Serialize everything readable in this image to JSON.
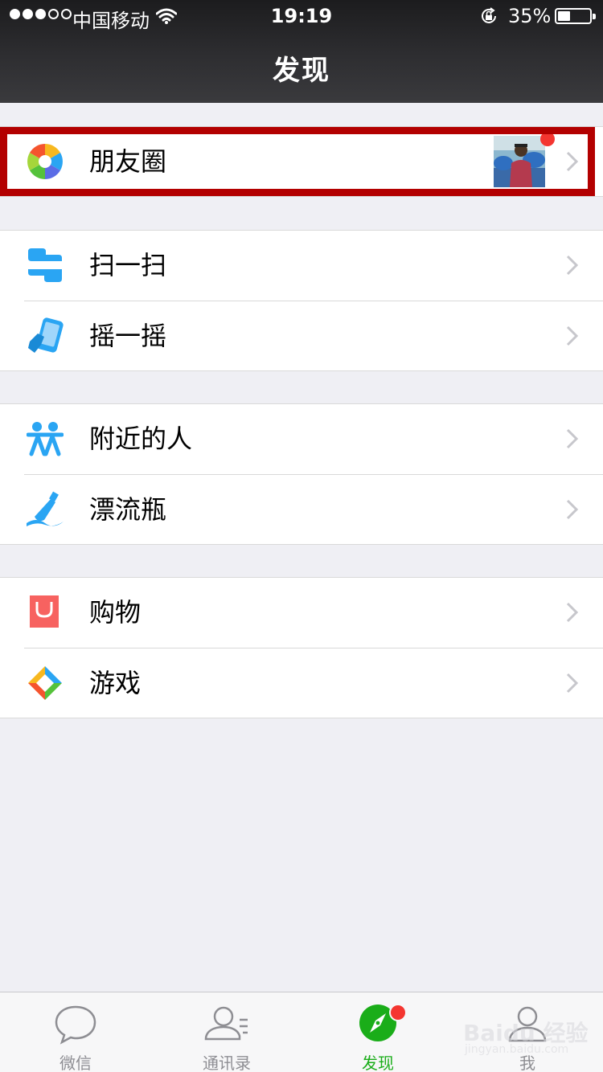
{
  "status_bar": {
    "signal_bars": 3,
    "signal_total": 5,
    "carrier": "中国移动",
    "time": "19:19",
    "battery_percent": "35%",
    "battery_level": 0.35
  },
  "nav": {
    "title": "发现"
  },
  "menu": {
    "moments": {
      "label": "朋友圈",
      "icon": "moments-aperture-icon",
      "has_new_badge": true,
      "highlighted": true
    },
    "scan": {
      "label": "扫一扫",
      "icon": "scan-icon"
    },
    "shake": {
      "label": "摇一摇",
      "icon": "shake-phone-icon"
    },
    "nearby": {
      "label": "附近的人",
      "icon": "people-nearby-icon"
    },
    "bottle": {
      "label": "漂流瓶",
      "icon": "drift-bottle-icon"
    },
    "shopping": {
      "label": "购物",
      "icon": "shopping-bag-icon"
    },
    "games": {
      "label": "游戏",
      "icon": "games-icon"
    }
  },
  "tabbar": {
    "tabs": [
      {
        "label": "微信",
        "icon": "chat-bubble-icon",
        "active": false
      },
      {
        "label": "通讯录",
        "icon": "contacts-icon",
        "active": false
      },
      {
        "label": "发现",
        "icon": "compass-icon",
        "active": true,
        "badge": true
      },
      {
        "label": "我",
        "icon": "profile-icon",
        "active": false
      }
    ]
  },
  "watermark": {
    "logo": "Baidu 经验",
    "url": "jingyan.baidu.com"
  },
  "colors": {
    "accent_green": "#1aad19",
    "badge_red": "#f43530",
    "highlight_red": "#b30000",
    "icon_blue": "#2aa5f3",
    "shopping_red": "#f76260"
  }
}
